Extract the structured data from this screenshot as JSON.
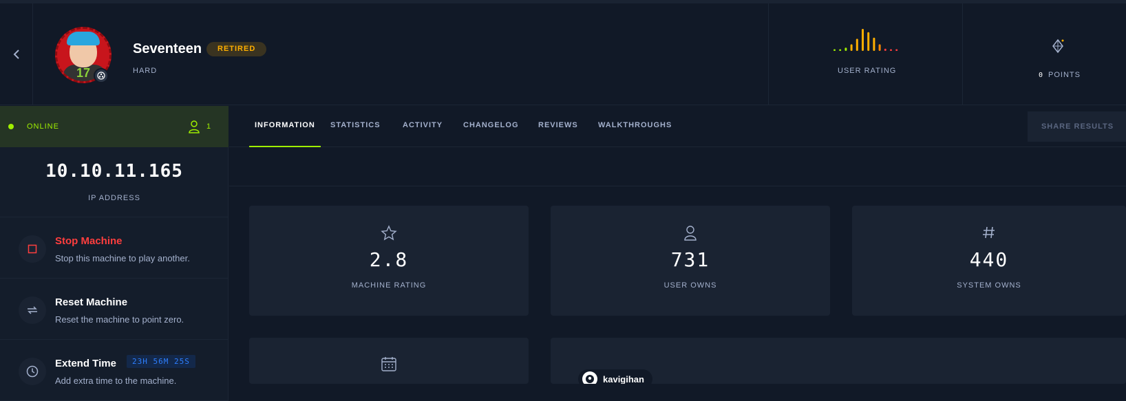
{
  "machine": {
    "name": "Seventeen",
    "status_badge": "RETIRED",
    "difficulty": "HARD"
  },
  "header": {
    "user_rating_label": "USER RATING",
    "rating_bar_heights": [
      0.08,
      0.08,
      0.15,
      0.3,
      0.55,
      1.0,
      0.85,
      0.6,
      0.3,
      0.1,
      0.08,
      0.08
    ],
    "rating_bar_colors": [
      "#9fef00",
      "#9fef00",
      "#9fef00",
      "#ffaf00",
      "#ffaf00",
      "#ffaf00",
      "#ffaf00",
      "#ffaf00",
      "#ff8800",
      "#ff3e3e",
      "#ff3e3e",
      "#ff3e3e"
    ],
    "points_value": "0",
    "points_label": "POINTS"
  },
  "sidebar": {
    "status_text": "ONLINE",
    "players_count": "1",
    "ip": "10.10.11.165",
    "ip_label": "IP ADDRESS",
    "actions": [
      {
        "title": "Stop Machine",
        "desc": "Stop this machine to play another.",
        "icon": "square-icon",
        "color": "#ff3e3e"
      },
      {
        "title": "Reset Machine",
        "desc": "Reset the machine to point zero.",
        "icon": "reset-icon",
        "color": "#ffffff"
      },
      {
        "title": "Extend Time",
        "desc": "Add extra time to the machine.",
        "icon": "clock-icon",
        "color": "#ffffff",
        "timer": "23H 56M 25S"
      }
    ]
  },
  "tabs": [
    "INFORMATION",
    "STATISTICS",
    "ACTIVITY",
    "CHANGELOG",
    "REVIEWS",
    "WALKTHROUGHS"
  ],
  "share_button": "SHARE RESULTS",
  "stats": [
    {
      "value": "2.8",
      "label": "MACHINE RATING",
      "icon": "star-icon"
    },
    {
      "value": "731",
      "label": "USER OWNS",
      "icon": "user-icon"
    },
    {
      "value": "440",
      "label": "SYSTEM OWNS",
      "icon": "hash-icon"
    }
  ],
  "user_chip": {
    "name": "kavigihan"
  },
  "colors": {
    "accent": "#9fef00",
    "danger": "#ff3e3e",
    "retired": "#ffaf00",
    "timer": "#2e7fff"
  }
}
